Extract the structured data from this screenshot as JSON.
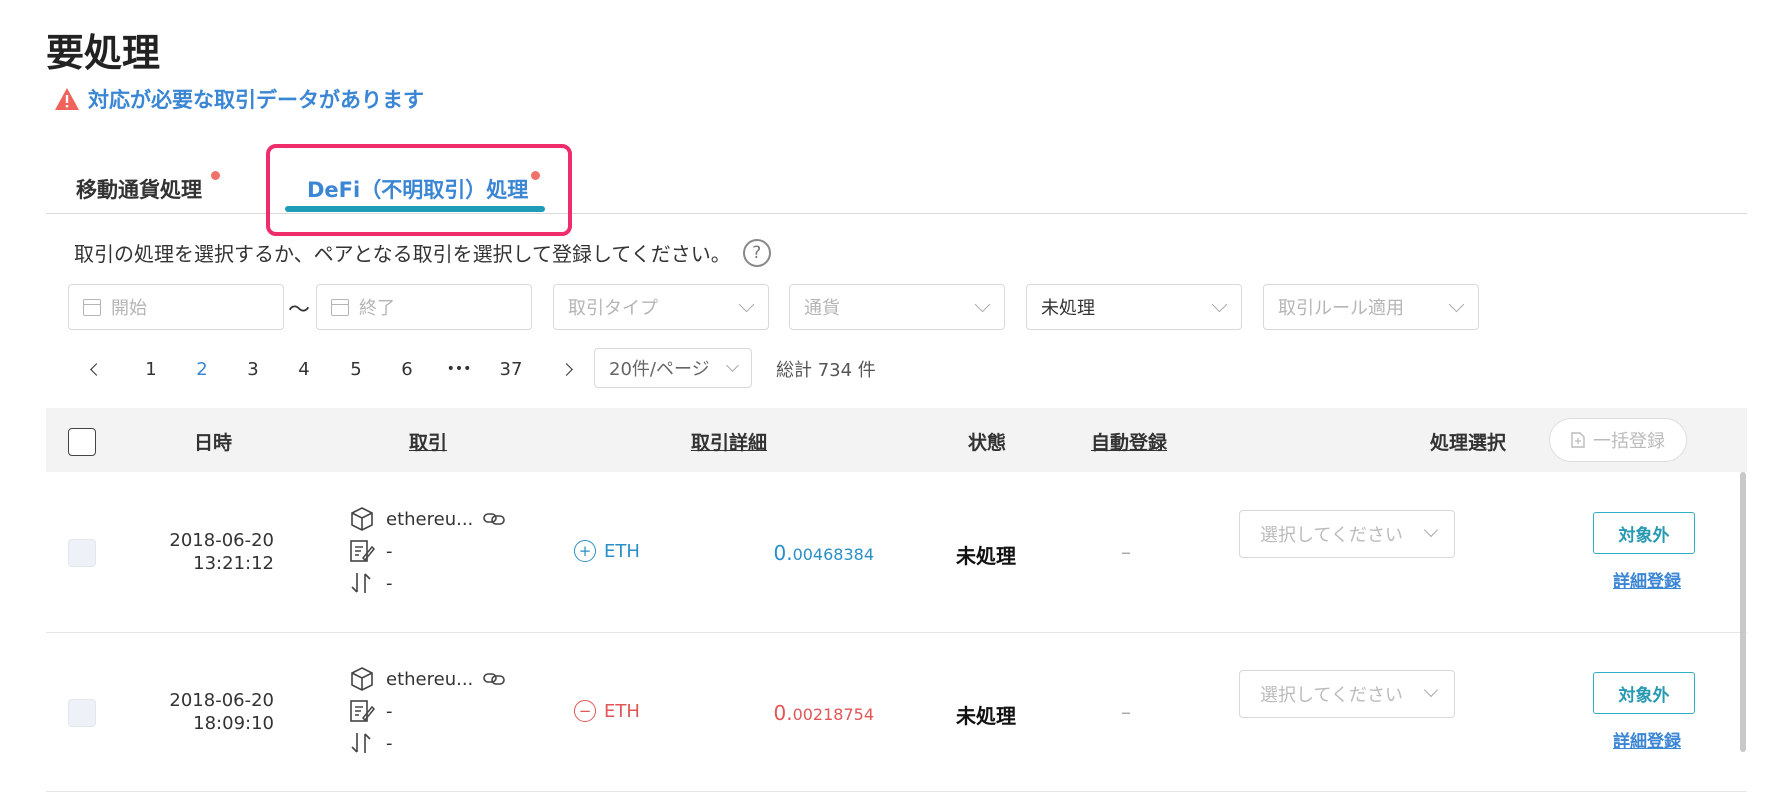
{
  "page": {
    "title": "要処理",
    "alert": "対応が必要な取引データがあります"
  },
  "tabs": [
    {
      "label": "移動通貨処理",
      "has_dot": true
    },
    {
      "label": "DeFi（不明取引）処理",
      "has_dot": true,
      "active": true
    }
  ],
  "instruction": "取引の処理を選択するか、ペアとなる取引を選択して登録してください。",
  "help_icon": "?",
  "filters": {
    "start_placeholder": "開始",
    "separator": "〜",
    "end_placeholder": "終了",
    "type_placeholder": "取引タイプ",
    "currency_placeholder": "通貨",
    "status_value": "未処理",
    "rule_placeholder": "取引ルール適用"
  },
  "pagination": {
    "pages": [
      "1",
      "2",
      "3",
      "4",
      "5",
      "6",
      "•••",
      "37"
    ],
    "current": "2",
    "page_size": "20件/ページ",
    "total": "総計 734 件"
  },
  "table": {
    "headers": {
      "datetime": "日時",
      "transaction": "取引",
      "detail": "取引詳細",
      "status": "状態",
      "auto": "自動登録",
      "action": "処理選択"
    },
    "bulk_button": "一括登録",
    "rows": [
      {
        "date": "2018-06-20",
        "time": "13:21:12",
        "source": "ethereu...",
        "memo": "-",
        "pair": "-",
        "direction": "in",
        "currency": "ETH",
        "amount_int": "0.",
        "amount_frac": "00468384",
        "status": "未処理",
        "auto": "–",
        "select_placeholder": "選択してください",
        "exclude_button": "対象外",
        "detail_link": "詳細登録"
      },
      {
        "date": "2018-06-20",
        "time": "18:09:10",
        "source": "ethereu...",
        "memo": "-",
        "pair": "-",
        "direction": "out",
        "currency": "ETH",
        "amount_int": "0.",
        "amount_frac": "00218754",
        "status": "未処理",
        "auto": "–",
        "select_placeholder": "選択してください",
        "exclude_button": "対象外",
        "detail_link": "詳細登録"
      }
    ]
  },
  "colors": {
    "accent": "#3a86d4",
    "teal": "#1e9bb7",
    "highlight": "#ee2d6a",
    "dot": "#f0706a",
    "negative": "#e05656",
    "positive": "#2a8fc7"
  }
}
